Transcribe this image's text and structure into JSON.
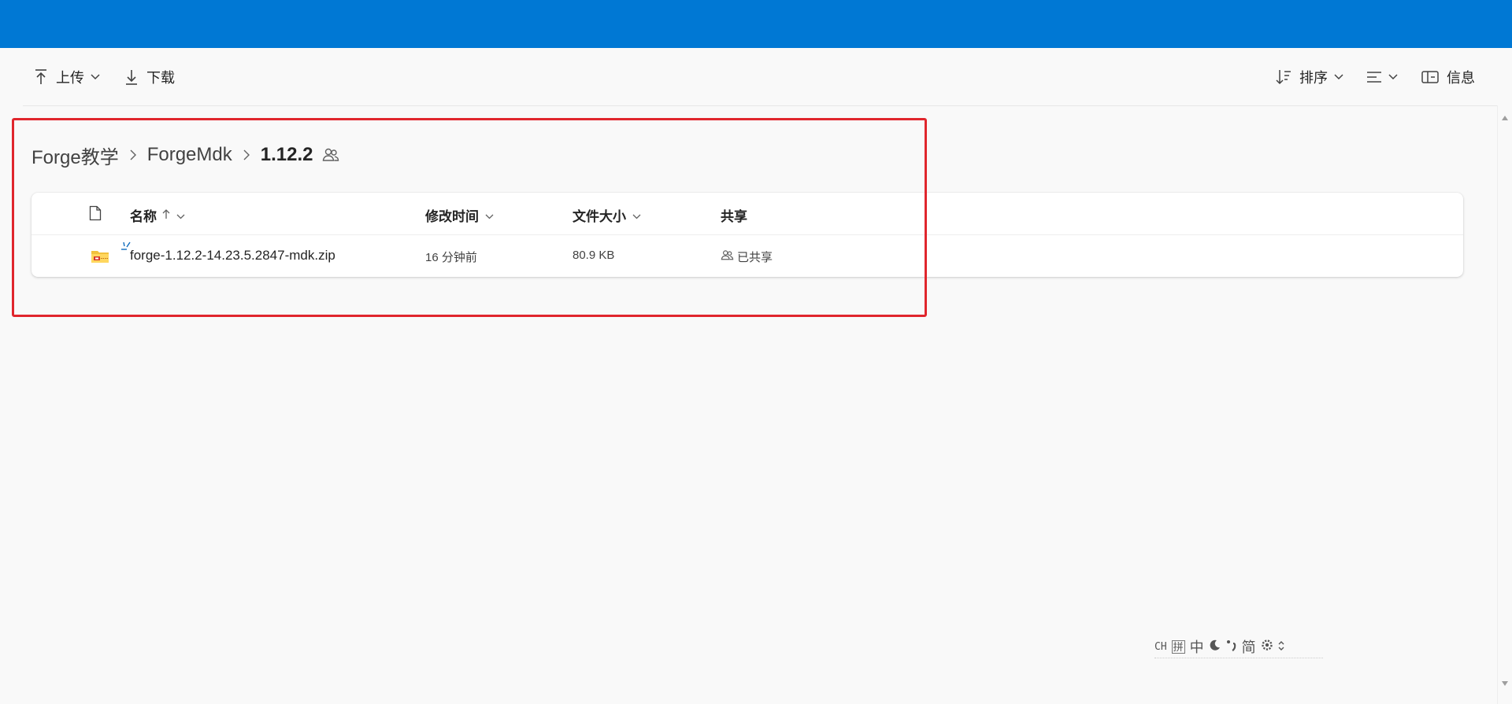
{
  "toolbar": {
    "upload_label": "上传",
    "download_label": "下载",
    "sort_label": "排序",
    "info_label": "信息"
  },
  "breadcrumb": {
    "items": [
      "Forge教学",
      "ForgeMdk"
    ],
    "current": "1.12.2"
  },
  "filelist": {
    "columns": {
      "name": "名称",
      "modified": "修改时间",
      "size": "文件大小",
      "sharing": "共享"
    },
    "rows": [
      {
        "name": "forge-1.12.2-14.23.5.2847-mdk.zip",
        "modified": "16 分钟前",
        "size": "80.9 KB",
        "sharing": "已共享"
      }
    ]
  },
  "ime_bar": {
    "lang": "CH",
    "pinyin": "拼",
    "chinese": "中",
    "simplified": "简"
  },
  "colors": {
    "top_bar": "#0078d4",
    "highlight_box": "#e0262d",
    "background": "#f9f9f9"
  }
}
